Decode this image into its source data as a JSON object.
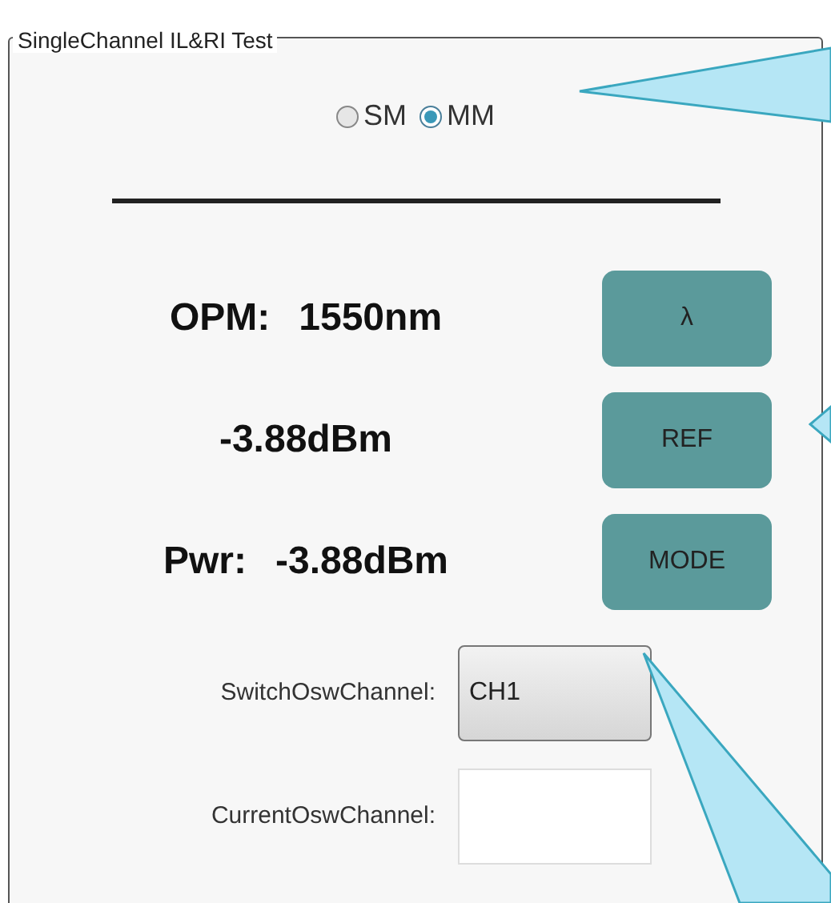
{
  "group": {
    "title": "SingleChannel IL&RI Test"
  },
  "fiber_modes": [
    {
      "label": "SM",
      "selected": false
    },
    {
      "label": "MM",
      "selected": true
    }
  ],
  "readings": [
    {
      "label": "OPM:",
      "value": "1550nm"
    },
    {
      "value": "-3.88dBm"
    },
    {
      "label": "Pwr:",
      "value": "-3.88dBm"
    }
  ],
  "buttons": [
    "λ",
    "REF",
    "MODE"
  ],
  "switch_osw_channel": {
    "label": "SwitchOswChannel:",
    "value": "CH1"
  },
  "current_osw_channel": {
    "label": "CurrentOswChannel:"
  }
}
